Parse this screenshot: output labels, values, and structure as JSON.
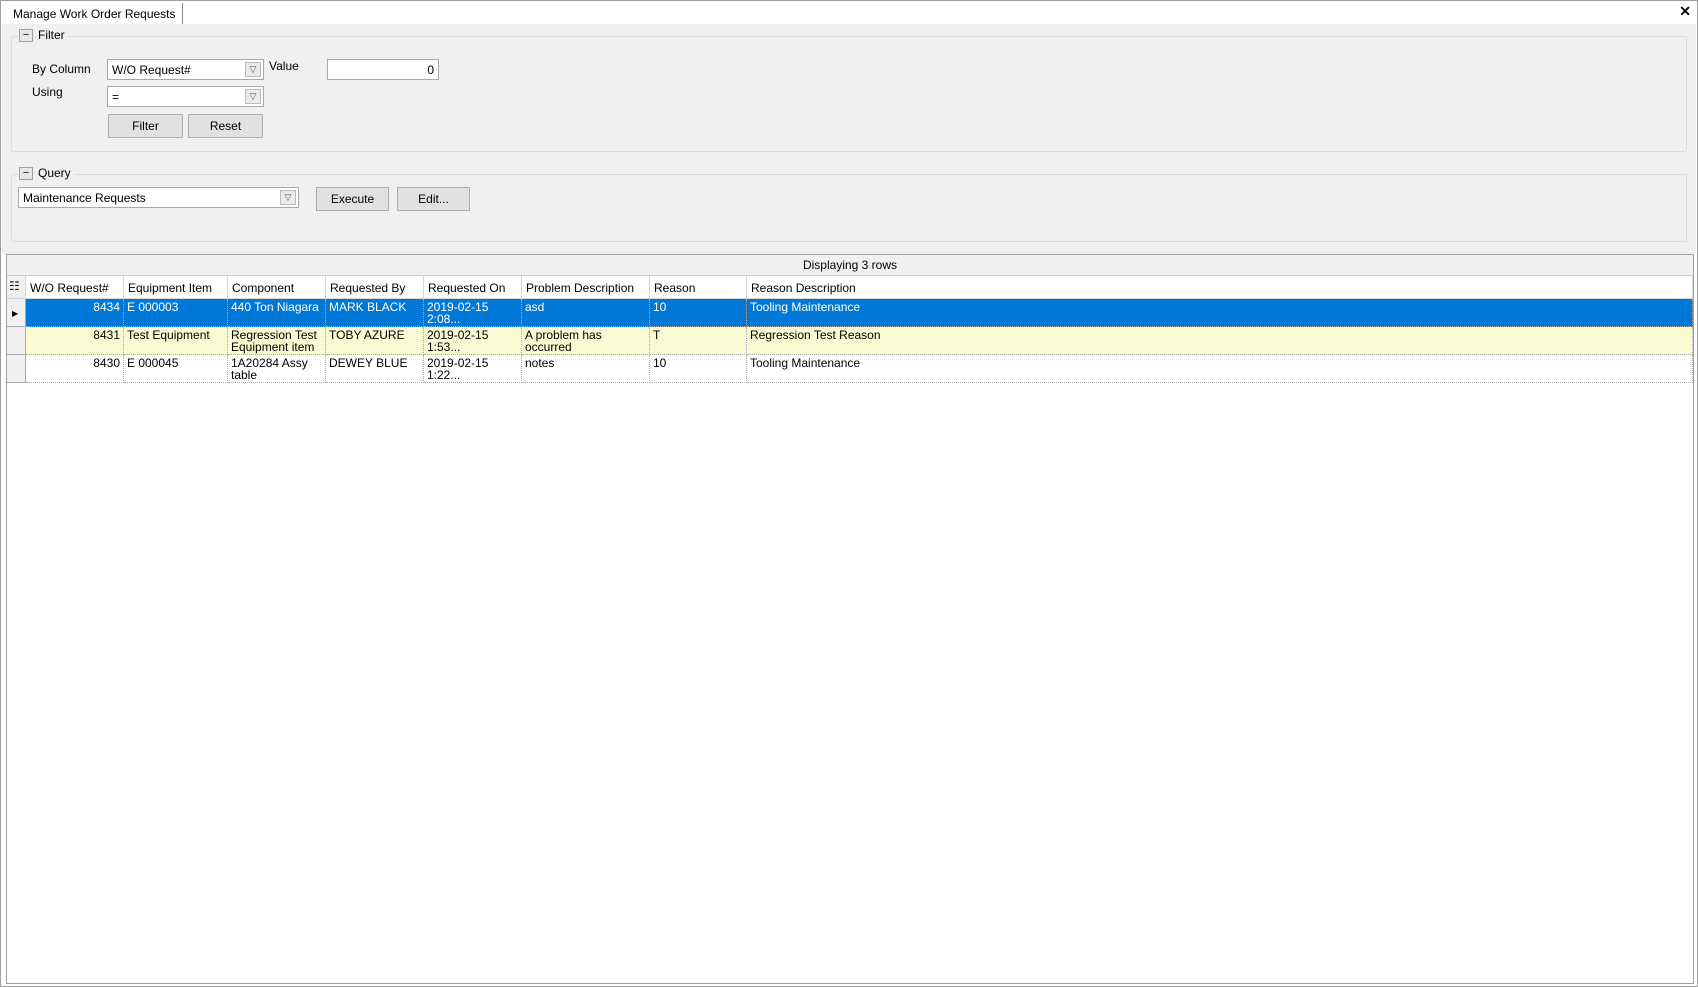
{
  "window": {
    "tab_title": "Manage Work Order Requests",
    "close": "✕"
  },
  "filter": {
    "title": "Filter",
    "toggle": "−",
    "by_column_label": "By Column",
    "by_column_value": "W/O Request#",
    "value_label": "Value",
    "value": "0",
    "using_label": "Using",
    "using_value": "=",
    "filter_button": "Filter",
    "reset_button": "Reset"
  },
  "query": {
    "title": "Query",
    "toggle": "−",
    "selected": "Maintenance Requests",
    "execute_button": "Execute",
    "edit_button": "Edit..."
  },
  "grid": {
    "caption": "Displaying 3 rows",
    "columns": [
      "W/O Request#",
      "Equipment Item",
      "Component",
      "Requested By",
      "Requested On",
      "Problem Description",
      "Reason",
      "Reason Description"
    ],
    "rows": [
      {
        "id": "8434",
        "equipment": "E 000003",
        "component": "440 Ton Niagara",
        "requested_by": "MARK BLACK",
        "requested_on": "2019-02-15  2:08...",
        "problem": "asd",
        "reason": "10",
        "reason_desc": "Tooling Maintenance"
      },
      {
        "id": "8431",
        "equipment": "Test Equipment",
        "component": "Regression Test Equipment item",
        "requested_by": "TOBY AZURE",
        "requested_on": "2019-02-15  1:53...",
        "problem": "A problem has occurred",
        "reason": "T",
        "reason_desc": "Regression Test Reason"
      },
      {
        "id": "8430",
        "equipment": "E 000045",
        "component": "1A20284 Assy table",
        "requested_by": "DEWEY BLUE",
        "requested_on": "2019-02-15  1:22...",
        "problem": "notes",
        "reason": "10",
        "reason_desc": "Tooling Maintenance"
      }
    ],
    "selected_row_color": "#0078d7",
    "alt_row_color": "#fafad2"
  }
}
